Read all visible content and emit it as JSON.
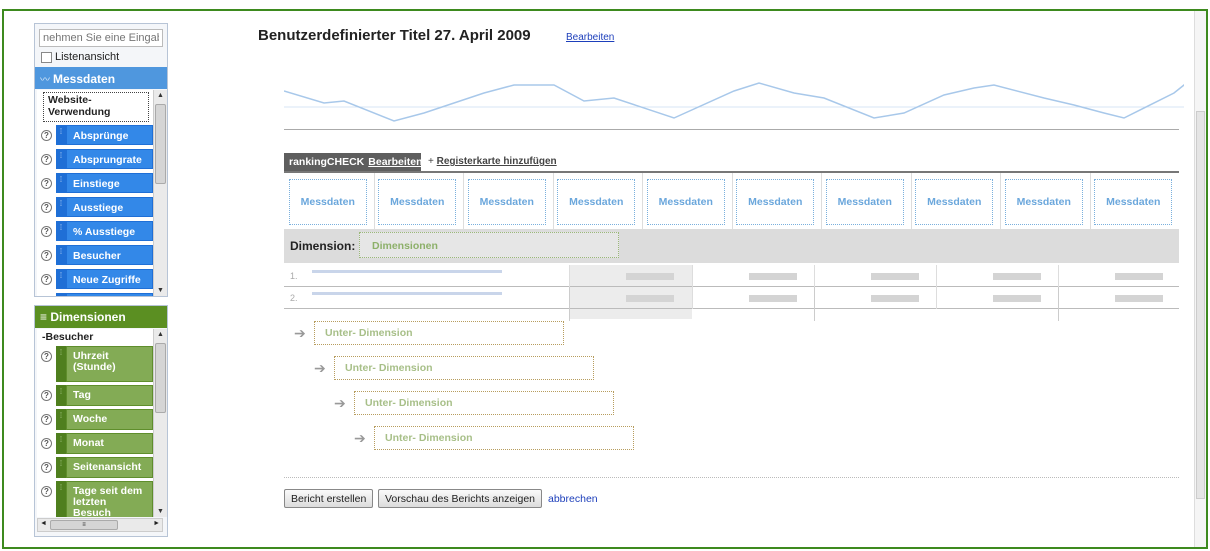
{
  "sidebar": {
    "search_placeholder": "nehmen Sie eine Eingab",
    "list_view_label": "Listenansicht",
    "metrics_header": "Messdaten",
    "metrics_group": "Website-Verwendung",
    "metrics": [
      "Absprünge",
      "Absprungrate",
      "Einstiege",
      "Ausstiege",
      "% Ausstiege",
      "Besucher",
      "Neue Zugriffe"
    ],
    "dimensions_header": "Dimensionen",
    "dimensions_group": "Besucher",
    "dimensions": [
      "Uhrzeit (Stunde)",
      "Tag",
      "Woche",
      "Monat",
      "Seitenansicht",
      "Tage seit dem letzten Besuch"
    ]
  },
  "report": {
    "title": "Benutzerdefinierter Titel 27. April 2009",
    "edit_link": "Bearbeiten",
    "tab_name": "rankingCHECK",
    "tab_edit": "Bearbeiten",
    "add_tab_prefix": "+",
    "add_tab": "Registerkarte hinzufügen",
    "metric_slots": [
      "Messdaten",
      "Messdaten",
      "Messdaten",
      "Messdaten",
      "Messdaten",
      "Messdaten",
      "Messdaten",
      "Messdaten",
      "Messdaten",
      "Messdaten"
    ],
    "dimension_label": "Dimension:",
    "dimension_slot": "Dimensionen",
    "rows": [
      "1.",
      "2."
    ],
    "subdimension_prefix": "Unter-",
    "subdimension_word": "Dimension"
  },
  "buttons": {
    "create": "Bericht erstellen",
    "preview": "Vorschau des Berichts anzeigen",
    "cancel": "abbrechen"
  },
  "colors": {
    "frame": "#3d8a1e",
    "metric_blue": "#3388e8",
    "dimension_green": "#83ab55",
    "link": "#1d3fbb"
  },
  "icons": {
    "help": "help-icon",
    "drag": "drag-handle-icon",
    "arrow": "arrow-right-icon"
  }
}
